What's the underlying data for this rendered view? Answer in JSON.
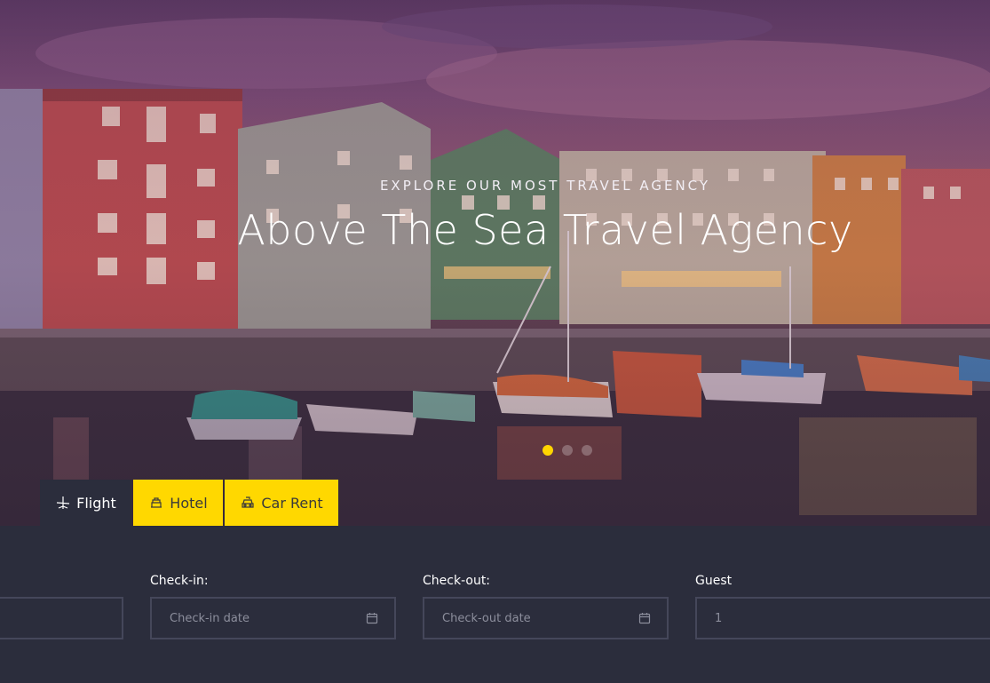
{
  "hero": {
    "kicker": "EXPLORE OUR MOST TRAVEL AGENCY",
    "title": "Above The Sea Travel Agency",
    "slides": 3,
    "active_slide": 1,
    "accent_color": "#ffd500"
  },
  "tabs": [
    {
      "label": "Flight",
      "icon": "plane-icon",
      "active": true
    },
    {
      "label": "Hotel",
      "icon": "hotel-icon",
      "active": false
    },
    {
      "label": "Car Rent",
      "icon": "taxi-icon",
      "active": false
    }
  ],
  "form": {
    "checkin": {
      "label": "Check-in:",
      "placeholder": "Check-in date",
      "icon": "calendar-icon"
    },
    "checkout": {
      "label": "Check-out:",
      "placeholder": "Check-out date",
      "icon": "calendar-icon"
    },
    "guest": {
      "label": "Guest",
      "value": "1"
    }
  }
}
